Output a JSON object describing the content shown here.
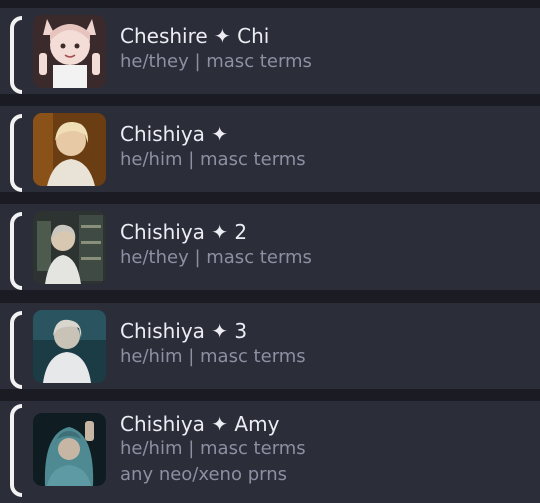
{
  "members": [
    {
      "name": "Cheshire ✦ Chi",
      "pronouns": "he/they | masc terms",
      "avatar": "cat-ear-drawn-avatar"
    },
    {
      "name": "Chishiya ✦",
      "pronouns": "he/him | masc terms",
      "avatar": "blond-portrait-avatar"
    },
    {
      "name": "Chishiya ✦ 2",
      "pronouns": "he/they | masc terms",
      "avatar": "shelves-portrait-avatar"
    },
    {
      "name": "Chishiya ✦ 3",
      "pronouns": "he/him | masc terms",
      "avatar": "teal-portrait-avatar"
    },
    {
      "name": "Chishiya ✦ Amy",
      "pronouns": "he/him | masc terms",
      "extra": "any neo/xeno prns",
      "avatar": "hooded-portrait-avatar"
    }
  ]
}
